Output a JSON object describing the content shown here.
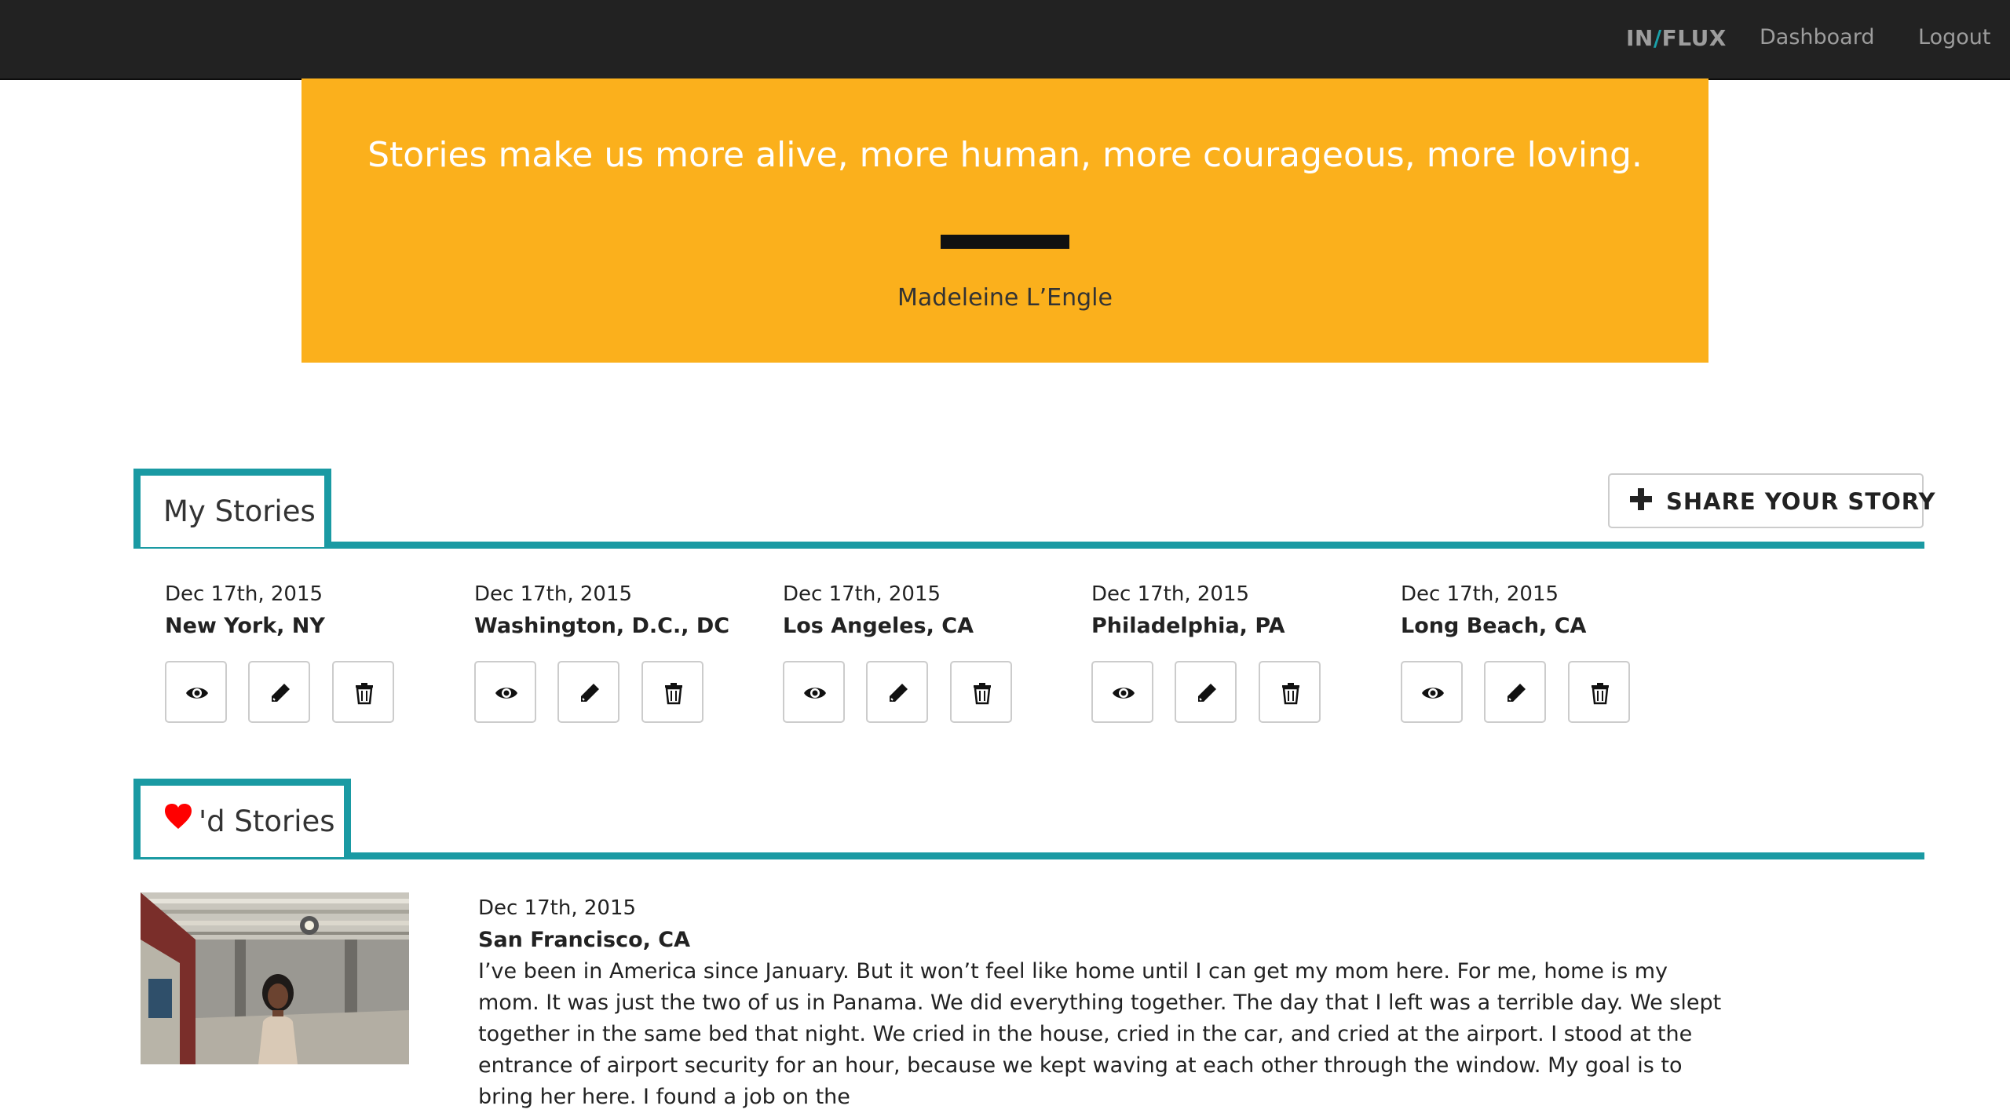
{
  "nav": {
    "brand_in": "IN",
    "brand_slash": "/",
    "brand_flux": "FLUX",
    "dashboard": "Dashboard",
    "logout": "Logout"
  },
  "quote": {
    "text": "Stories make us more alive, more human, more courageous, more loving.",
    "author": "Madeleine L’Engle"
  },
  "my_stories": {
    "title": "My Stories",
    "share_button": "SHARE YOUR STORY",
    "items": [
      {
        "date": "Dec 17th, 2015",
        "location": "New York, NY"
      },
      {
        "date": "Dec 17th, 2015",
        "location": "Washington, D.C., DC"
      },
      {
        "date": "Dec 17th, 2015",
        "location": "Los Angeles, CA"
      },
      {
        "date": "Dec 17th, 2015",
        "location": "Philadelphia, PA"
      },
      {
        "date": "Dec 17th, 2015",
        "location": "Long Beach, CA"
      }
    ]
  },
  "liked_stories": {
    "title": "'d Stories",
    "items": [
      {
        "date": "Dec 17th, 2015",
        "location": "San Francisco, CA",
        "body": "I’ve been in America since January. But it won’t feel like home until I can get my mom here. For me, home is my mom. It was just the two of us in Panama. We did everything together. The day that I left was a terrible day. We slept together in the same bed that night. We cried in the house, cried in the car, and cried at the airport. I stood at the entrance of airport security for an hour, because we kept waving at each other through the window. My goal is to bring her here. I found a job on the"
      }
    ]
  },
  "colors": {
    "nav_bg": "#222222",
    "accent_teal": "#1a9aa3",
    "banner_yellow": "#fbb01c",
    "heart_red": "#ff0000"
  },
  "icons": {
    "view": "eye-icon",
    "edit": "pencil-icon",
    "delete": "trash-icon",
    "add": "plus-icon",
    "liked": "heart-icon"
  }
}
